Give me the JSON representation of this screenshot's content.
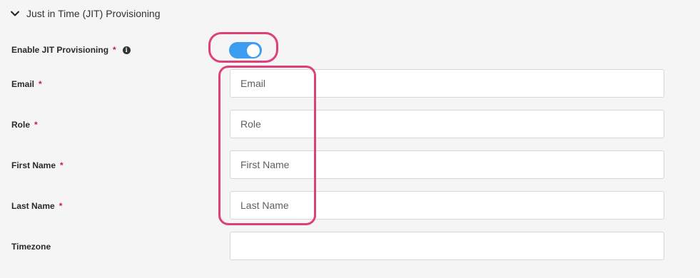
{
  "section": {
    "title": "Just in Time (JIT) Provisioning",
    "expanded": true
  },
  "fields": {
    "enable_jit": {
      "label": "Enable JIT Provisioning",
      "required_mark": "*",
      "value": true
    },
    "email": {
      "label": "Email",
      "required_mark": "*",
      "placeholder": "Email"
    },
    "role": {
      "label": "Role",
      "required_mark": "*",
      "placeholder": "Role"
    },
    "first_name": {
      "label": "First Name",
      "required_mark": "*",
      "placeholder": "First Name"
    },
    "last_name": {
      "label": "Last Name",
      "required_mark": "*",
      "placeholder": "Last Name"
    },
    "timezone": {
      "label": "Timezone",
      "placeholder": ""
    }
  },
  "colors": {
    "toggle_on": "#3d9df0",
    "required_mark": "#c2185b",
    "highlight_annotation": "#e0407a"
  }
}
